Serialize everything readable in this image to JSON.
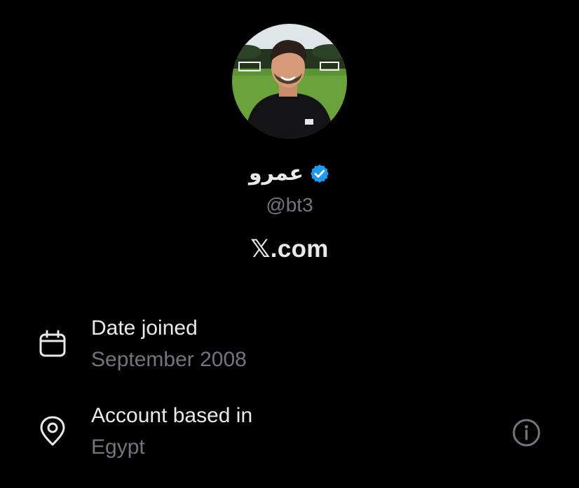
{
  "colors": {
    "background": "#000000",
    "primary_text": "#e7e9ea",
    "secondary_text": "#71767b",
    "verified_badge": "#1d9bf0"
  },
  "profile": {
    "avatar_icon": "profile-photo",
    "display_name": "عمرو",
    "verified_icon": "verified-badge-icon",
    "handle": "@bt3"
  },
  "site": {
    "label": "𝕏.com"
  },
  "about": {
    "date_joined": {
      "icon": "calendar-icon",
      "title": "Date joined",
      "value": "September 2008"
    },
    "account_based_in": {
      "icon": "location-pin-icon",
      "title": "Account based in",
      "value": "Egypt",
      "info_icon": "info-icon"
    }
  }
}
